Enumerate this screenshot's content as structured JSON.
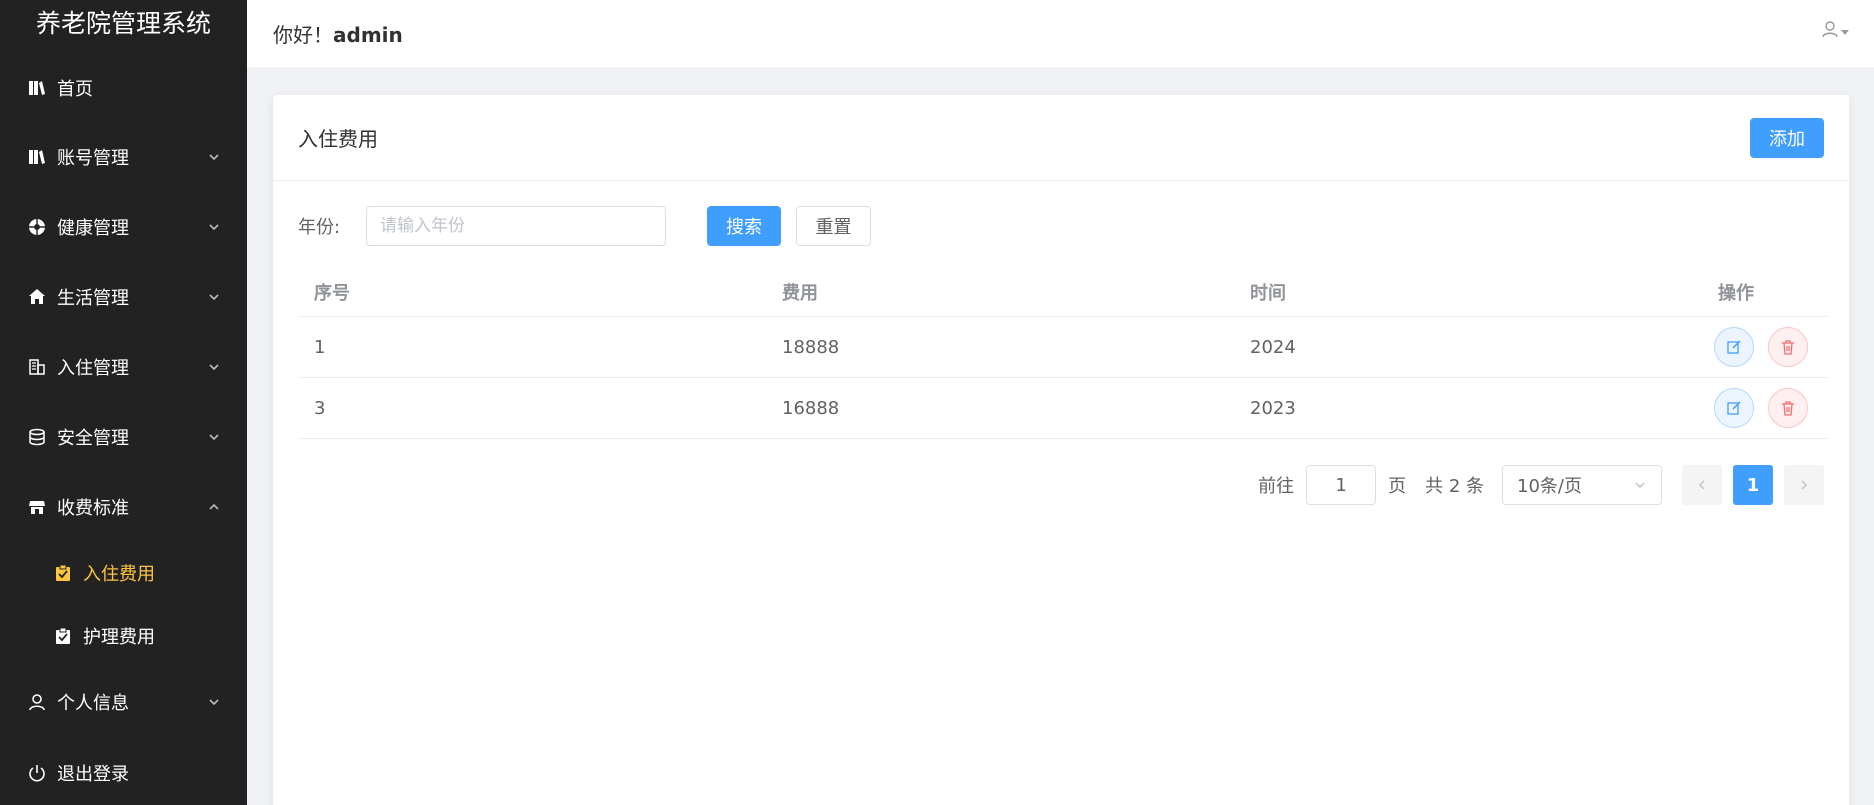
{
  "sidebar": {
    "brand": "养老院管理系统",
    "items": [
      {
        "label": "首页",
        "icon": "book-icon"
      },
      {
        "label": "账号管理",
        "icon": "book-icon"
      },
      {
        "label": "健康管理",
        "icon": "aperture-icon"
      },
      {
        "label": "生活管理",
        "icon": "home-icon"
      },
      {
        "label": "入住管理",
        "icon": "office-building-icon"
      },
      {
        "label": "安全管理",
        "icon": "database-icon"
      },
      {
        "label": "收费标准",
        "icon": "shop-icon"
      },
      {
        "label": "个人信息",
        "icon": "user-icon"
      },
      {
        "label": "退出登录",
        "icon": "power-icon"
      }
    ],
    "subitems": [
      {
        "label": "入住费用",
        "icon": "clipboard-check-icon",
        "active": true
      },
      {
        "label": "护理费用",
        "icon": "clipboard-check-icon",
        "active": false
      }
    ],
    "active_color": "#ffc53d",
    "background": "#222222"
  },
  "header": {
    "greeting": "你好！",
    "username": "admin"
  },
  "card": {
    "title": "入住费用",
    "add_label": "添加"
  },
  "filter": {
    "label": "年份:",
    "placeholder": "请输入年份",
    "value": "",
    "search_label": "搜索",
    "reset_label": "重置"
  },
  "table": {
    "headers": [
      "序号",
      "费用",
      "时间",
      "操作"
    ],
    "rows": [
      {
        "id": "1",
        "fee": "18888",
        "year": "2024"
      },
      {
        "id": "3",
        "fee": "16888",
        "year": "2023"
      }
    ]
  },
  "pagination": {
    "goto_label": "前往",
    "goto_value": "1",
    "page_unit": "页",
    "total_text": "共 2 条",
    "page_size": "10条/页",
    "current_page": "1"
  },
  "colors": {
    "primary": "#409eff",
    "danger": "#f56c6c"
  }
}
